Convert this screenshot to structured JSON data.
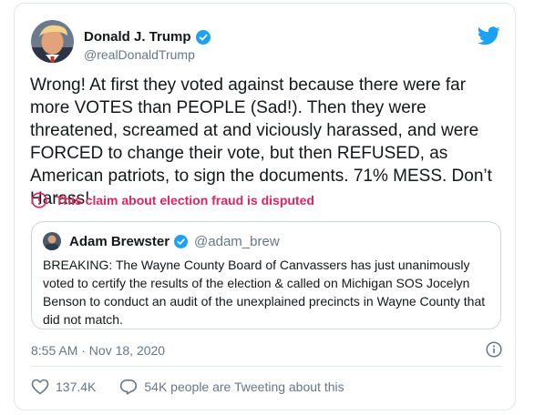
{
  "tweet": {
    "author_name": "Donald J. Trump",
    "author_handle": "@realDonaldTrump",
    "text": "Wrong! At first they voted against because there were far more VOTES than PEOPLE (Sad!). Then they were threatened, screamed at and viciously harassed, and were FORCED to change their vote, but then REFUSED, as American patriots, to sign the documents. 71% MESS. Don’t Harass!",
    "disputed_label": "This claim about election fraud is disputed",
    "timestamp": "8:55 AM · Nov 18, 2020",
    "likes": "137.4K",
    "talking_label": "54K people are Tweeting about this"
  },
  "quote": {
    "author_name": "Adam Brewster",
    "author_handle": "@adam_brew",
    "text": "BREAKING: The Wayne County Board of Canvassers has just unanimously voted to certify the results of the election & called on Michigan SOS Jocelyn Benson to conduct an audit of the unexplained precincts in Wayne County that did not match."
  },
  "colors": {
    "brand_blue": "#1da1f2",
    "disputed_red": "#e0245e",
    "secondary_text": "#657786",
    "border": "#e1e8ed"
  },
  "icons": [
    "verified-badge-icon",
    "twitter-bird-icon",
    "alert-circle-icon",
    "info-icon",
    "heart-icon",
    "comment-icon"
  ]
}
